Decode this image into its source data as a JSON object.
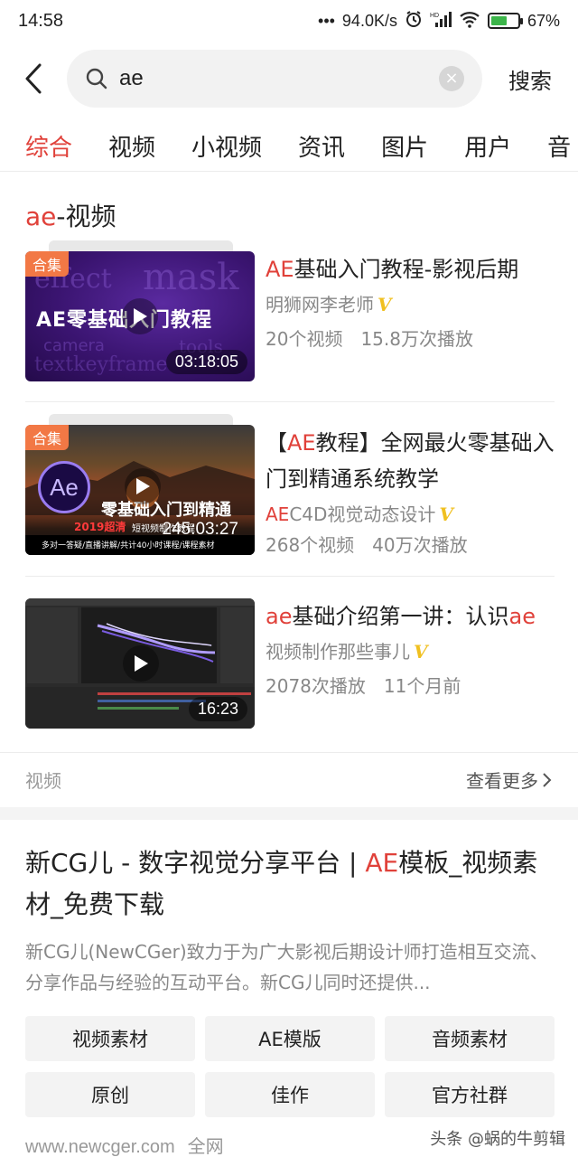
{
  "status_bar": {
    "time": "14:58",
    "dots": "•••",
    "net_speed": "94.0K/s",
    "alarm_icon": "alarm-clock-icon",
    "signal_label": "HD",
    "signal_icon": "cell-signal-icon",
    "wifi_icon": "wifi-icon",
    "battery_percent": "67%",
    "battery_level": 0.67
  },
  "search": {
    "back_icon": "chevron-left-icon",
    "search_icon": "magnifier-icon",
    "query": "ae",
    "clear_icon": "close-circle-icon",
    "button_label": "搜索"
  },
  "tabs": [
    {
      "label": "综合",
      "active": true
    },
    {
      "label": "视频",
      "active": false
    },
    {
      "label": "小视频",
      "active": false
    },
    {
      "label": "资讯",
      "active": false
    },
    {
      "label": "图片",
      "active": false
    },
    {
      "label": "用户",
      "active": false
    },
    {
      "label": "音",
      "active": false
    }
  ],
  "video_section": {
    "title_highlight": "ae",
    "title_rest": "-视频",
    "items": [
      {
        "badge": "合集",
        "thumb_caption": "AE零基础入门教程",
        "duration": "03:18:05",
        "title_highlight": "AE",
        "title_rest": "基础入门教程-影视后期",
        "author": "明狮网李老师",
        "verified": "V",
        "stats": "20个视频　15.8万次播放"
      },
      {
        "badge": "合集",
        "thumb_logo": "Ae",
        "thumb_caption": "零基础入门到精通",
        "thumb_year": "2019超清",
        "thumb_sub": "短视频制作教程",
        "thumb_footer": "多对一答疑/直播讲解/共计40小时课程/课程素材",
        "duration": "245:03:27",
        "title_prefix": "【",
        "title_highlight": "AE",
        "title_rest": "教程】全网最火零基础入门到精通系统教学",
        "author_highlight": "AE",
        "author": "C4D视觉动态设计",
        "verified": "V",
        "stats": "268个视频　40万次播放"
      },
      {
        "duration": "16:23",
        "title_highlight": "ae",
        "title_rest": "基础介绍第一讲：认识",
        "title_highlight_end": "ae",
        "author": "视频制作那些事儿",
        "verified": "V",
        "stats": "2078次播放　11个月前"
      }
    ],
    "footer_label": "视频",
    "more_label": "查看更多"
  },
  "web_result": {
    "title_pre": "新CG儿 - 数字视觉分享平台 | ",
    "title_highlight": "AE",
    "title_post": "模板_视频素材_免费下载",
    "description": "新CG儿(NewCGer)致力于为广大影视后期设计师打造相互交流、分享作品与经验的互动平台。新CG儿同时还提供...",
    "chips": [
      "视频素材",
      "AE模版",
      "音频素材",
      "原创",
      "佳作",
      "官方社群"
    ],
    "url": "www.newcger.com",
    "scope": "全网"
  },
  "watermark": "头条 @蜗的牛剪辑",
  "colors": {
    "accent": "#e0413a",
    "badge": "#f27845",
    "verified": "#f0c020",
    "battery": "#3cb54a"
  }
}
